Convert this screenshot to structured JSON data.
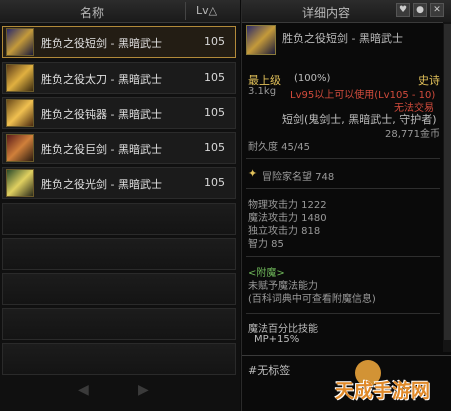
{
  "list_header": {
    "name": "名称",
    "lv": "Lv△"
  },
  "items": [
    {
      "name": "胜负之役短剑 - 黑暗武士",
      "level": "105",
      "selected": true
    },
    {
      "name": "胜负之役太刀 - 黑暗武士",
      "level": "105",
      "selected": false
    },
    {
      "name": "胜负之役钝器 - 黑暗武士",
      "level": "105",
      "selected": false
    },
    {
      "name": "胜负之役巨剑 - 黑暗武士",
      "level": "105",
      "selected": false
    },
    {
      "name": "胜负之役光剑 - 黑暗武士",
      "level": "105",
      "selected": false
    }
  ],
  "pager": {
    "prev": "◀",
    "next": "▶"
  },
  "detail": {
    "title": "详细内容",
    "item_name": "胜负之役短剑 - 黑暗武士",
    "grade": "最上级",
    "grade_pct": "(100%)",
    "rarity": "史诗",
    "weight": "3.1kg",
    "level_req": "Lv95以上可以使用(Lv105 - 10)",
    "trade": "无法交易",
    "classes": "短剑(鬼剑士, 黑暗武士, 守护者)",
    "price": "28,771金币",
    "durability": "耐久度 45/45",
    "reputation": "冒险家名望 748",
    "stats": [
      "物理攻击力 1222",
      "魔法攻击力 1480",
      "独立攻击力 818",
      "智力 85"
    ],
    "enchant_title": "<附魔>",
    "enchant_line1": "未赋予魔法能力",
    "enchant_line2": "(百科词典中可查看附魔信息)",
    "skill_title": "魔法百分比技能",
    "skill_value": "MP+15%",
    "tag": "#无标签"
  },
  "watermark": "天成手游网",
  "colors": {
    "accent": "#e2c15a",
    "red": "#d24b3c",
    "green": "#6fb85a",
    "selected_border": "#b28a3a"
  },
  "icons": [
    "sort-arrow-icon",
    "shield-button-icon",
    "gear-button-icon",
    "close-icon",
    "star-icon"
  ]
}
